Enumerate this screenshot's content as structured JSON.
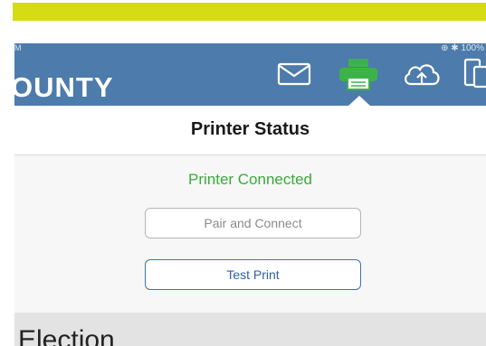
{
  "status_bar": {
    "left_text": "M",
    "right_text": "⊕ ✱ 100%"
  },
  "brand": {
    "text": "OUNTY"
  },
  "nav": {
    "icons": [
      "mail-icon",
      "printer-icon",
      "cloud-upload-icon",
      "devices-icon"
    ],
    "active_icon": "printer-icon"
  },
  "header": {
    "title": "Printer Status"
  },
  "printer": {
    "status": "Printer Connected",
    "pair_button_label": "Pair and Connect",
    "test_button_label": "Test Print"
  },
  "section": {
    "title": "Election"
  },
  "colors": {
    "accent_bar": "#d5dc14",
    "nav_background": "#4d7bab",
    "active_icon": "#3db24a",
    "status_connected": "#3aaa3a",
    "primary_button": "#3d74b0"
  }
}
